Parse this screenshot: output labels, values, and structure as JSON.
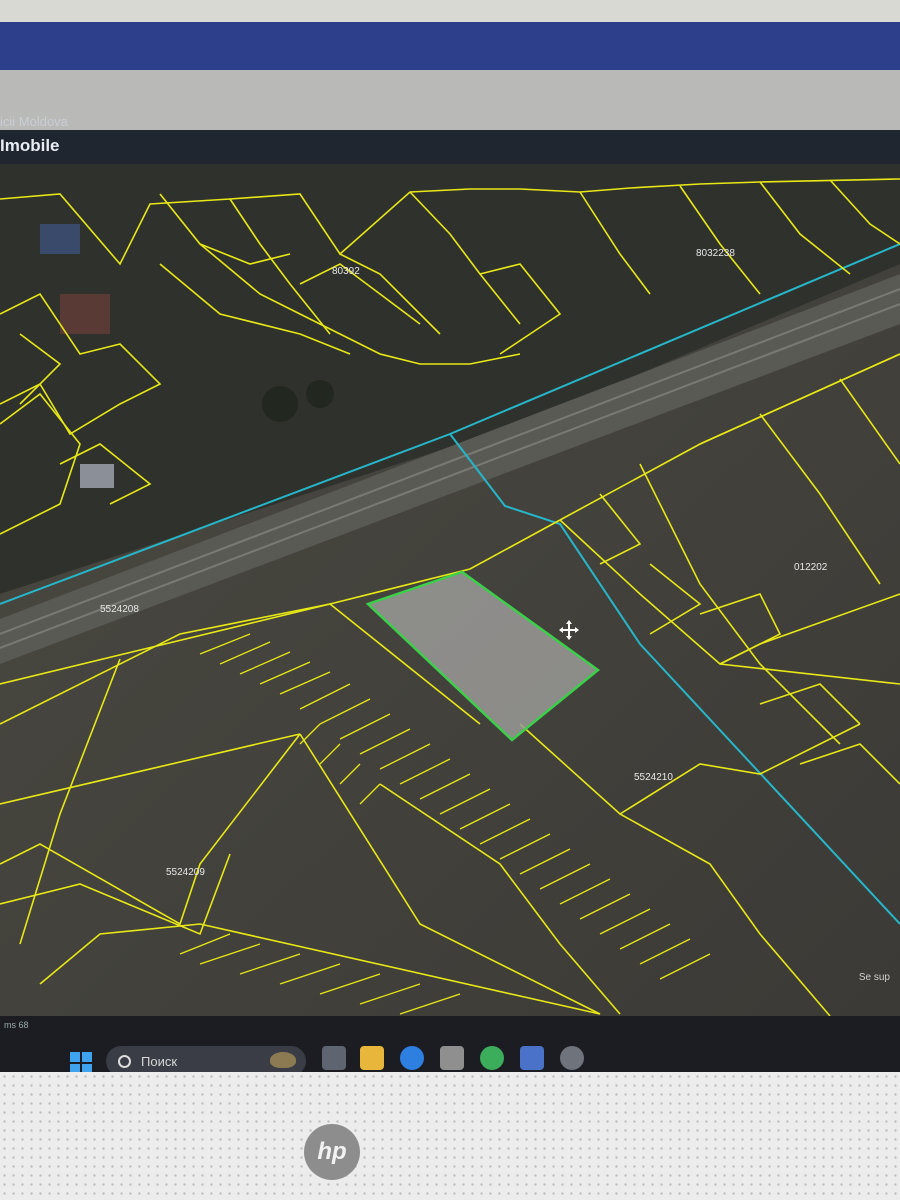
{
  "app": {
    "brand": "icii Moldova",
    "title": "Imobile"
  },
  "map": {
    "parcels": [
      {
        "id": "80392"
      },
      {
        "id": "8032238"
      },
      {
        "id": "5524208"
      },
      {
        "id": "012202"
      },
      {
        "id": "5524210"
      },
      {
        "id": "5524209"
      }
    ],
    "selected_parcel_color": "#3ccf4a",
    "parcel_border_color": "#e8e817",
    "road_line_color": "#27b6c9",
    "scale_text": "Se sup"
  },
  "taskbar": {
    "search_placeholder": "Поиск",
    "corner_text": "ms 68",
    "icons": [
      "task-view-icon",
      "file-explorer-icon",
      "edge-browser-icon",
      "store-icon",
      "chrome-icon",
      "solitaire-icon",
      "camera-icon"
    ]
  },
  "monitor": {
    "brand": "hp"
  }
}
